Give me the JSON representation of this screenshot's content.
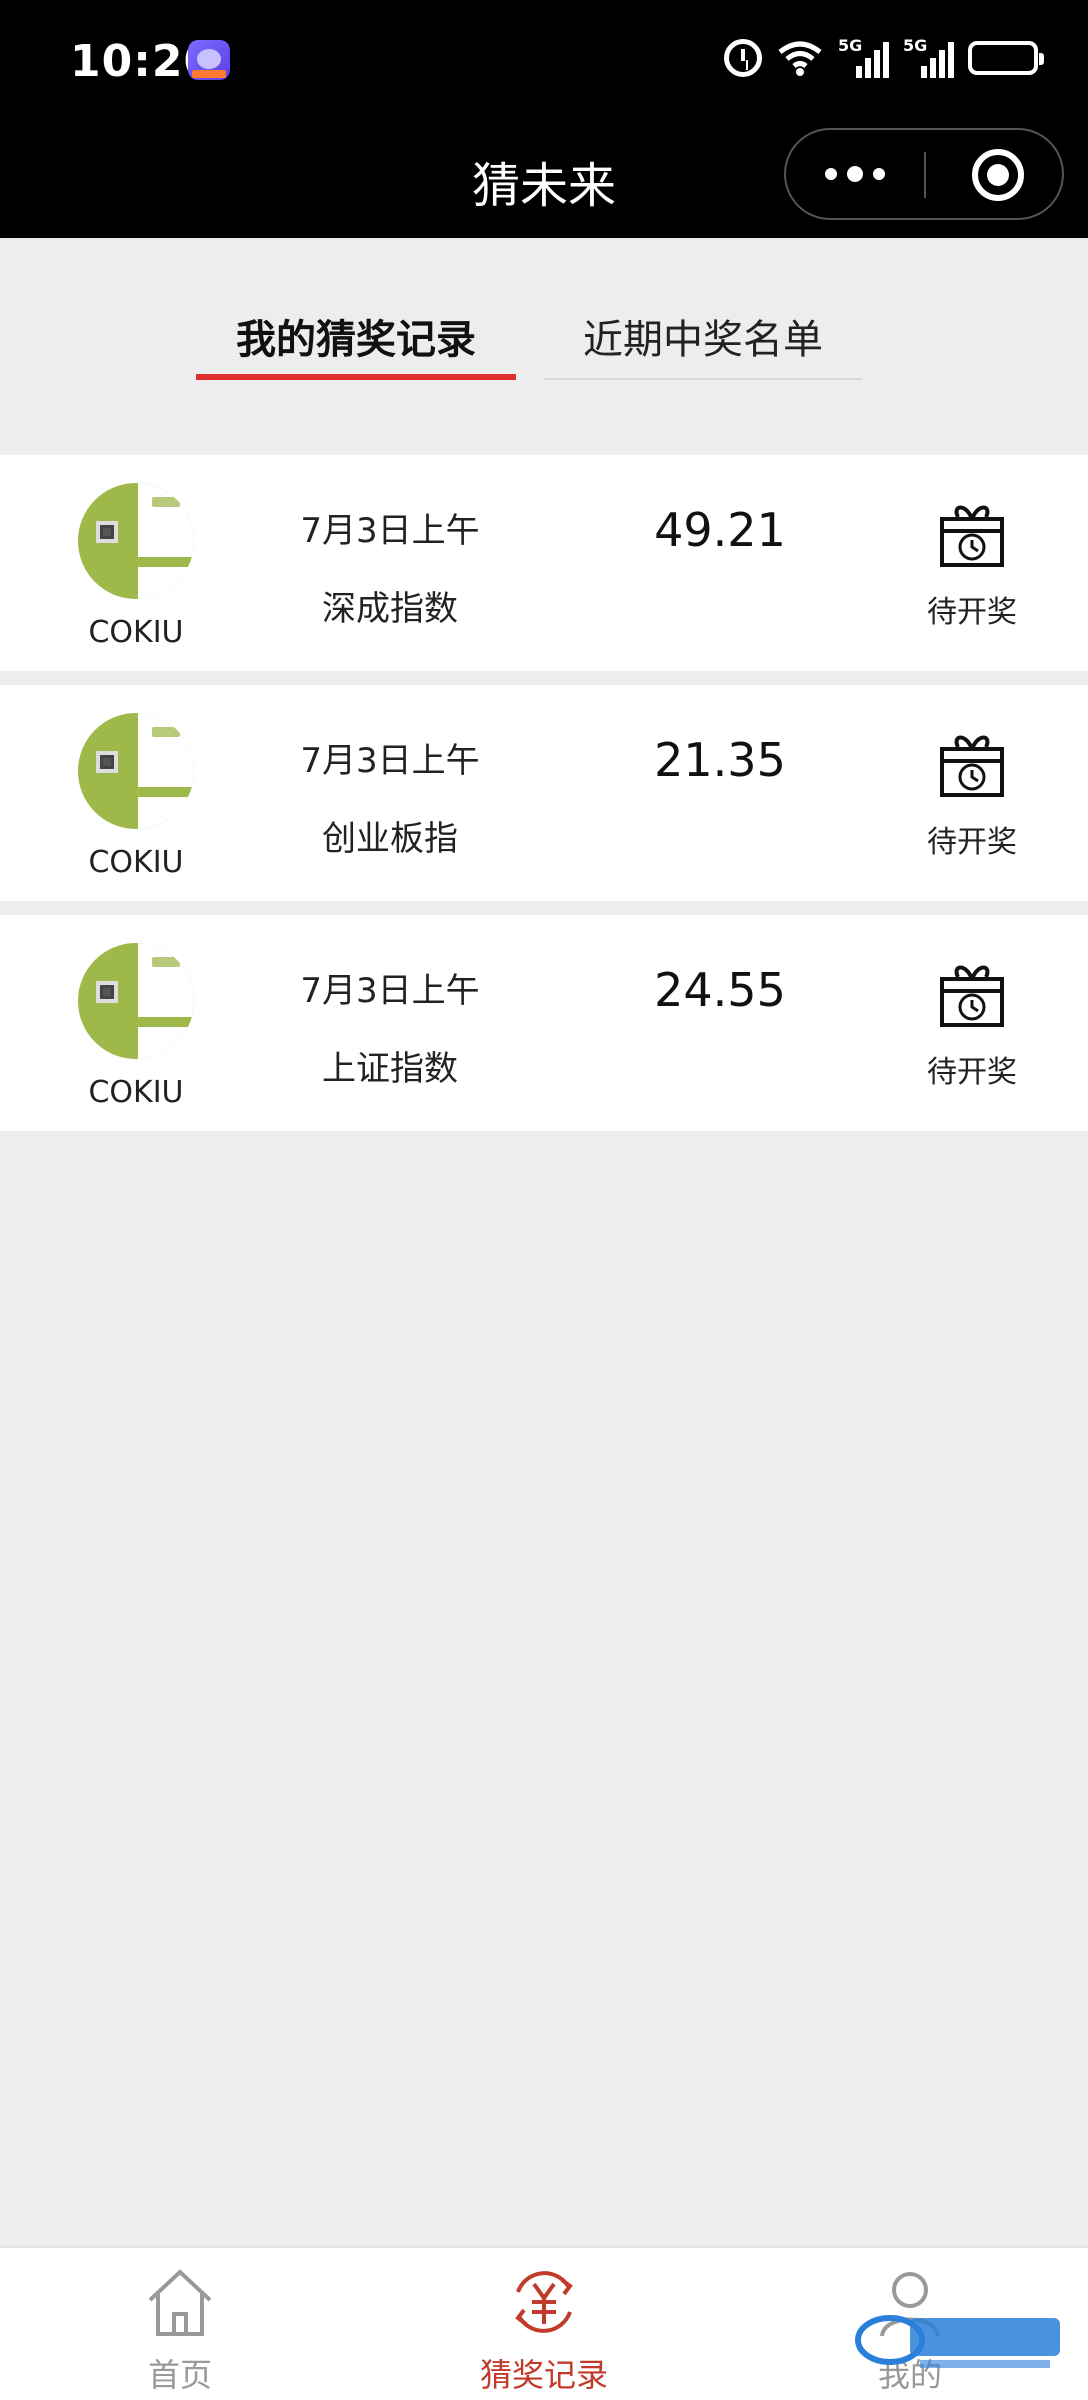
{
  "status_bar": {
    "time": "10:20",
    "network": [
      "5G",
      "5G"
    ]
  },
  "nav": {
    "title": "猜未来"
  },
  "tabs": [
    {
      "label": "我的猜奖记录",
      "active": true
    },
    {
      "label": "近期中奖名单",
      "active": false
    }
  ],
  "records": [
    {
      "user": "COKIU",
      "date": "7月3日上午",
      "index": "深成指数",
      "value": "49.21",
      "status": "待开奖"
    },
    {
      "user": "COKIU",
      "date": "7月3日上午",
      "index": "创业板指",
      "value": "21.35",
      "status": "待开奖"
    },
    {
      "user": "COKIU",
      "date": "7月3日上午",
      "index": "上证指数",
      "value": "24.55",
      "status": "待开奖"
    }
  ],
  "tabbar": [
    {
      "label": "首页",
      "icon": "home-icon",
      "active": false
    },
    {
      "label": "猜奖记录",
      "icon": "yuan-circle-icon",
      "active": true
    },
    {
      "label": "我的",
      "icon": "user-icon",
      "active": false
    }
  ],
  "colors": {
    "accent": "#e02f2f",
    "active_tab": "#c13a2a",
    "background": "#ededed",
    "avatar_green": "#9fb84a"
  }
}
